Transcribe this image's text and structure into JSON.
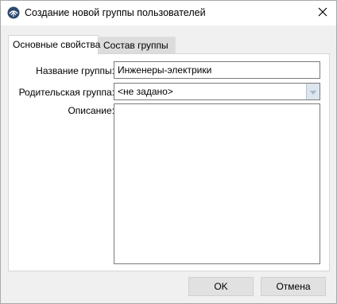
{
  "window": {
    "title": "Создание новой группы пользователей"
  },
  "icons": {
    "app": "app-logo-icon",
    "close": "close-icon",
    "dropdown": "chevron-down-icon"
  },
  "tabs": [
    {
      "label": "Основные свойства",
      "active": true
    },
    {
      "label": "Состав группы",
      "active": false
    }
  ],
  "form": {
    "name_label": "Название группы:",
    "name_value": "Инженеры-электрики",
    "parent_label": "Родительская группа:",
    "parent_value": "<не задано>",
    "description_label": "Описание:",
    "description_value": ""
  },
  "buttons": {
    "ok": "OK",
    "cancel": "Отмена"
  }
}
